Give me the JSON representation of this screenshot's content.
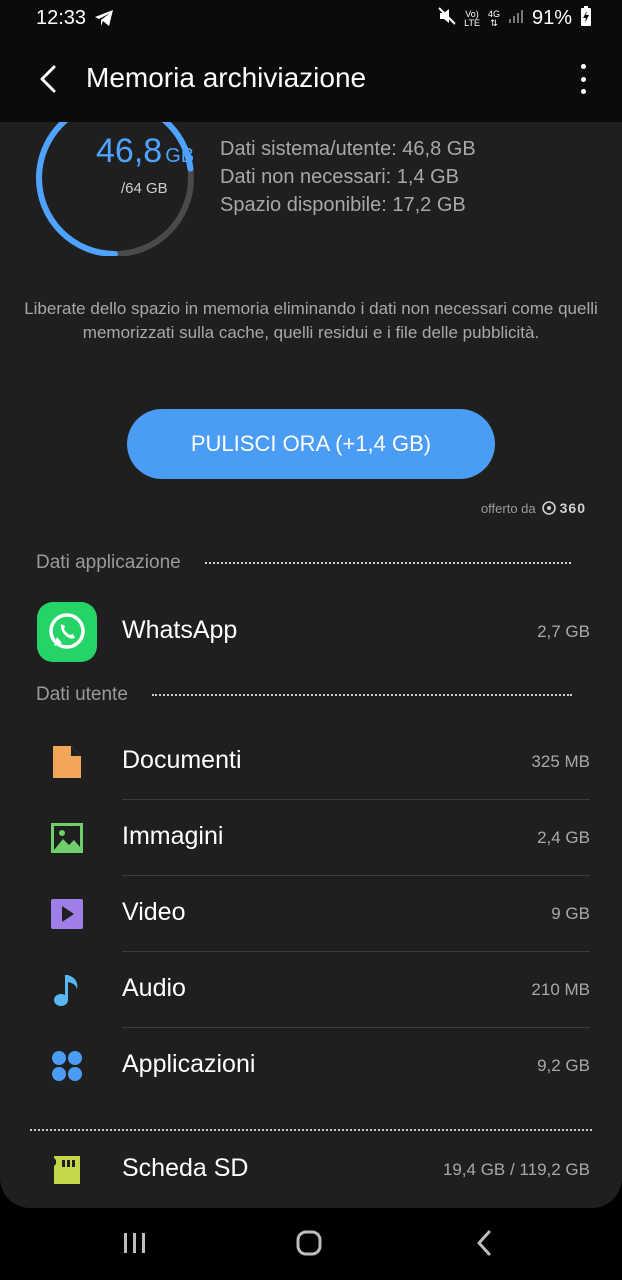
{
  "status_bar": {
    "time": "12:33",
    "net_top": "Vo)",
    "net_bottom": "LTE",
    "net4g": "4G",
    "battery": "91%"
  },
  "app_bar": {
    "title": "Memoria archiviazione"
  },
  "gauge": {
    "used_value": "46,8",
    "used_unit": "GB",
    "total": "/64 GB",
    "used_fraction": 0.73,
    "color": "#4da3ff"
  },
  "summary": {
    "line1": "Dati sistema/utente: 46,8 GB",
    "line2": "Dati non necessari: 1,4 GB",
    "line3": "Spazio disponibile: 17,2 GB"
  },
  "hint": "Liberate dello spazio in memoria eliminando i dati non necessari come quelli memorizzati sulla cache, quelli residui e i file delle pubblicità.",
  "clean_button": "PULISCI ORA (+1,4 GB)",
  "offered": {
    "label": "offerto da",
    "brand": "360"
  },
  "app_section": {
    "title": "Dati applicazione",
    "items": [
      {
        "name": "WhatsApp",
        "size": "2,7 GB",
        "icon": "whatsapp-icon",
        "color": "#25d366"
      }
    ]
  },
  "user_section": {
    "title": "Dati utente",
    "items": [
      {
        "name": "Documenti",
        "size": "325 MB",
        "icon": "document-icon",
        "color": "#f2a65a"
      },
      {
        "name": "Immagini",
        "size": "2,4 GB",
        "icon": "image-icon",
        "color": "#6fcf6a"
      },
      {
        "name": "Video",
        "size": "9 GB",
        "icon": "video-icon",
        "color": "#a07ee8"
      },
      {
        "name": "Audio",
        "size": "210 MB",
        "icon": "audio-icon",
        "color": "#58b7f0"
      },
      {
        "name": "Applicazioni",
        "size": "9,2 GB",
        "icon": "apps-icon",
        "color": "#4a9cf5"
      }
    ]
  },
  "sd_card": {
    "name": "Scheda SD",
    "size": "19,4 GB / 119,2 GB",
    "icon": "sd-card-icon",
    "color": "#c5d64a"
  }
}
